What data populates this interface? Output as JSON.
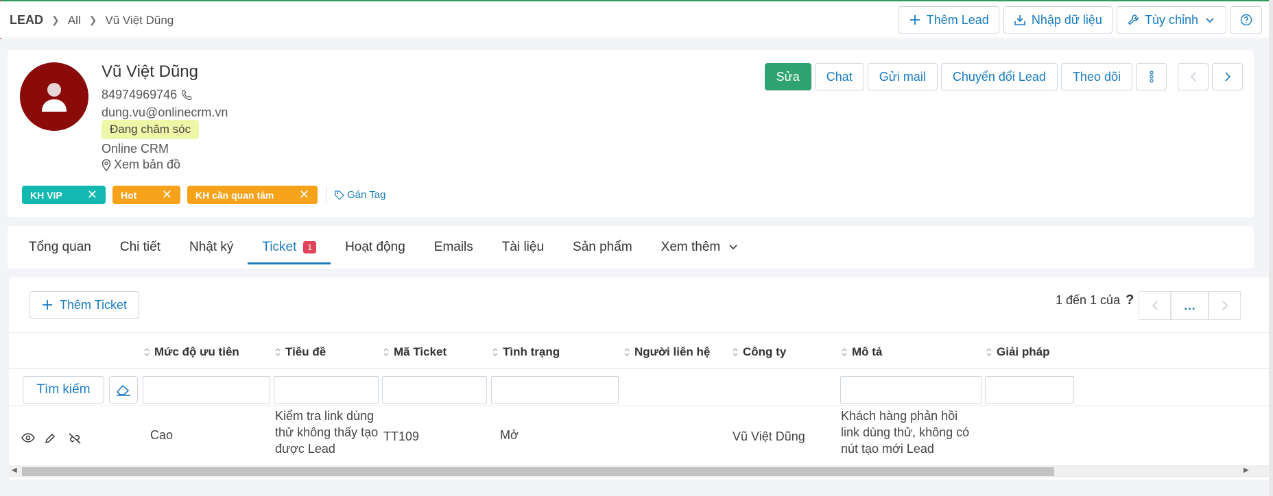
{
  "breadcrumb": {
    "root": "LEAD",
    "level1": "All",
    "current": "Vũ Việt Dũng"
  },
  "top_actions": {
    "add_lead": "Thêm Lead",
    "import": "Nhập dữ liệu",
    "customize": "Tùy chỉnh"
  },
  "profile": {
    "name": "Vũ Việt Dũng",
    "phone": "84974969746",
    "email": "dung.vu@onlinecrm.vn",
    "status": "Đang chăm sóc",
    "company": "Online CRM",
    "map": "Xem bản đồ"
  },
  "tags": [
    {
      "label": "KH VIP",
      "color": "#13b8b1"
    },
    {
      "label": "Hot",
      "color": "#f6a21a"
    },
    {
      "label": "KH cần quan tâm",
      "color": "#f6a21a"
    }
  ],
  "gan_tag": "Gán Tag",
  "card_actions": {
    "edit": "Sửa",
    "chat": "Chat",
    "mail": "Gửi mail",
    "convert": "Chuyển đổi Lead",
    "follow": "Theo dõi"
  },
  "tabs": {
    "overview": "Tổng quan",
    "detail": "Chi tiết",
    "log": "Nhật ký",
    "ticket": "Ticket",
    "ticket_count": "1",
    "activity": "Hoạt động",
    "emails": "Emails",
    "docs": "Tài liệu",
    "products": "Sản phẩm",
    "more": "Xem thêm"
  },
  "ticket_panel": {
    "add_ticket": "Thêm Ticket",
    "pager_text": "1 đến 1 của",
    "pager_help": "?",
    "pager_more": "…",
    "columns": {
      "priority": "Mức độ ưu tiên",
      "title": "Tiêu đề",
      "code": "Mã Ticket",
      "status": "Tình trạng",
      "contact": "Người liên hệ",
      "company": "Công ty",
      "description": "Mô tả",
      "solution": "Giải pháp"
    },
    "search_label": "Tìm kiếm",
    "rows": [
      {
        "priority": "Cao",
        "title": "Kiểm tra link dùng thử không thấy tạo được Lead",
        "code": "TT109",
        "status": "Mở",
        "contact": "",
        "company": "Vũ Việt Dũng",
        "description": "Khách hàng phản hồi link dùng thử, không có nút tạo mới Lead",
        "solution": ""
      }
    ]
  },
  "colors": {
    "accent": "#1a7bbf",
    "primary_button": "#2fa36f",
    "avatar_bg": "#8b0a0a",
    "status_bg": "#eef7a8",
    "badge": "#e0435a"
  }
}
